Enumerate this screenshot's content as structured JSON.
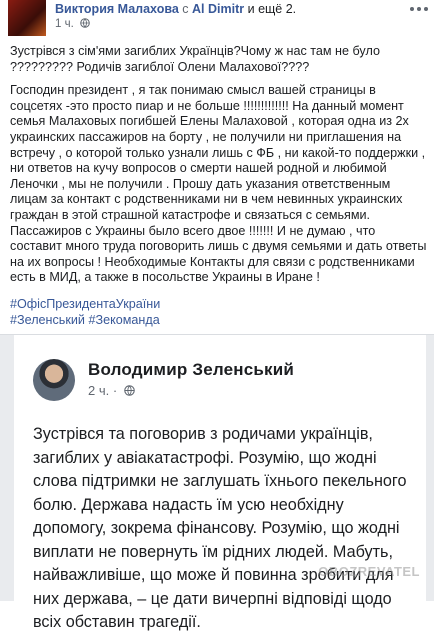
{
  "post": {
    "author": "Виктория Малахова",
    "tag_prefix": "с",
    "tagged_person": "Al Dimitr",
    "tag_suffix": "и ещё 2.",
    "time": "1 ч.",
    "paragraph_1": "Зустрівся з сім'ями загиблих Українців?Чому ж нас там не було ????????? Родичів загиблої Олени Малахової????",
    "paragraph_2": "Господин президент , я так понимаю смысл вашей страницы в соцсетях -это просто пиар и не больше !!!!!!!!!!!!! На данный момент семья Малаховых погибшей Елены Малаховой , которая одна из 2х украинских пассажиров на борту , не получили ни приглашения на встречу , о которой только узнали лишь с ФБ , ни какой-то поддержки , ни ответов на кучу вопросов о смерти нашей родной и любимой Леночки , мы не получили . Прошу дать указания ответственным лицам за контакт с родственниками ни в чем невинных украинских граждан в этой страшной катастрофе и связаться с семьями. Пассажиров с Украины было всего двое !!!!!!! И не думаю , что составит много труда поговорить лишь с двумя семьями и дать ответы на их вопросы ! Необходимые Контакты для связи с родственниками есть в МИД, а также в посольстве Украины в Иране !",
    "hashtags": [
      "#ОфісПрезидентаУкраїни",
      "#Зеленський",
      "#Зекоманда"
    ]
  },
  "shared": {
    "author": "Володимир Зеленський",
    "time": "2 ч.",
    "separator": "·",
    "text": "Зустрівся та поговорив з родичами українців, загиблих у авіакатастрофі. Розумію, що жодні слова підтримки не заглушать їхнього пекельного болю. Держава надасть їм усю необхідну допомогу, зокрема фінансову. Розумію, що жодні виплати не повернуть їм рідних людей. Мабуть, найважливіше, що може й повинна зробити для них держава, – це дати вичерпні відповіді щодо всіх обставин трагедії."
  },
  "watermark": "OBOZREVATEL",
  "colors": {
    "link": "#385898",
    "text": "#1c1e21",
    "muted": "#616770"
  }
}
